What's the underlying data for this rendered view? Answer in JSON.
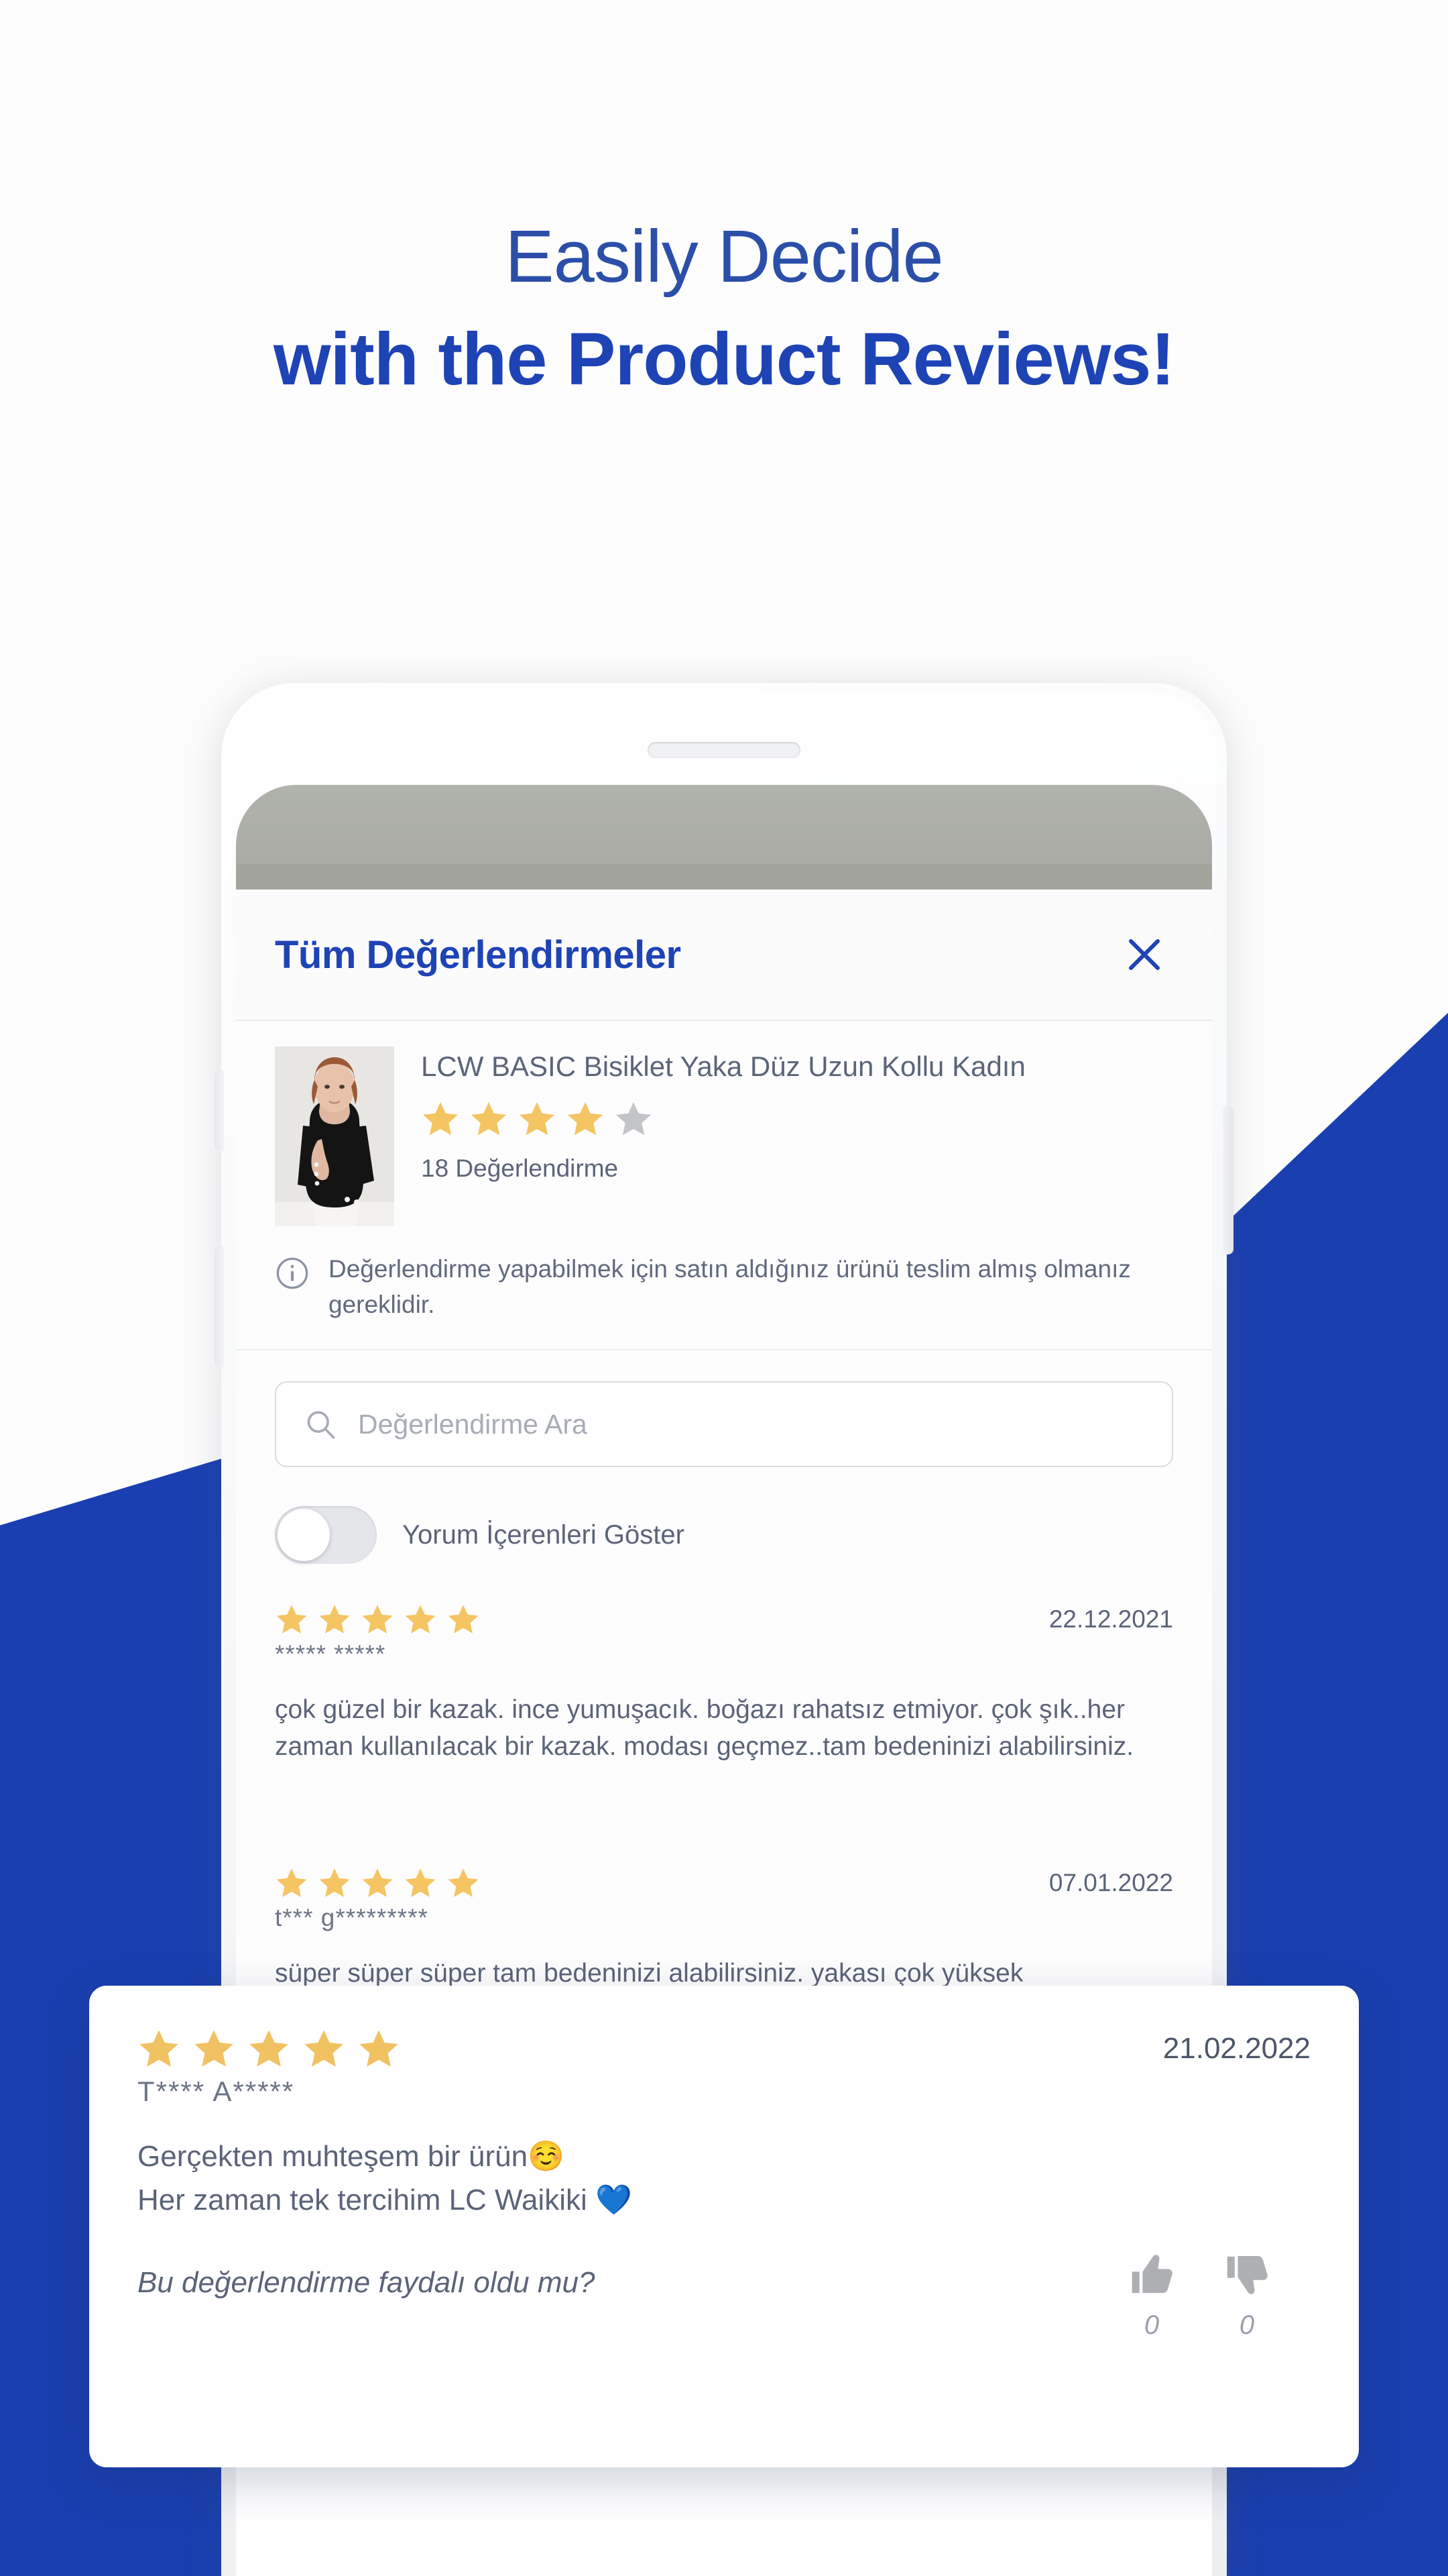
{
  "headline": {
    "line1": "Easily Decide",
    "line2": "with the Product Reviews!"
  },
  "colors": {
    "brand_blue": "#1E43B5",
    "wedge_blue": "#1A3FB0",
    "star_gold": "#F5C563",
    "star_gray": "#C3C5C9",
    "text_gray": "#5B6478"
  },
  "modal": {
    "title": "Tüm Değerlendirmeler",
    "close_icon": "close-icon"
  },
  "product": {
    "name": "LCW BASIC Bisiklet Yaka Düz Uzun Kollu Kadın",
    "rating": 4,
    "max_rating": 5,
    "review_count_label": "18 Değerlendirme",
    "thumbnail_alt": "product-thumbnail"
  },
  "notice": {
    "icon": "info-icon",
    "text": "Değerlendirme yapabilmek için satın aldığınız ürünü teslim almış olmanız gereklidir."
  },
  "search": {
    "icon": "search-icon",
    "placeholder": "Değerlendirme Ara",
    "value": ""
  },
  "filter_toggle": {
    "label": "Yorum İçerenleri Göster",
    "state": "off"
  },
  "reviews": [
    {
      "rating": 5,
      "date": "22.12.2021",
      "author": "***** *****",
      "text": "çok güzel bir kazak. ince yumuşacık. boğazı rahatsız etmiyor. çok şık..her zaman kullanılacak bir kazak. modası geçmez..tam bedeninizi alabilirsiniz."
    },
    {
      "rating": 5,
      "date": "07.01.2022",
      "author": "t*** g*********",
      "text": "süper süper süper tam bedeninizi alabilirsiniz. yakası çok yüksek"
    }
  ],
  "highlight_card": {
    "rating": 5,
    "date": "21.02.2022",
    "author": "T**** A*****",
    "body_line1": "Gerçekten muhteşem bir ürün☺️",
    "body_line2": "Her zaman tek tercihim LC Waikiki 💙",
    "helpful_question": "Bu değerlendirme faydalı oldu mu?",
    "thumbs_up_icon": "thumbs-up-icon",
    "thumbs_up_count": "0",
    "thumbs_down_icon": "thumbs-down-icon",
    "thumbs_down_count": "0"
  }
}
